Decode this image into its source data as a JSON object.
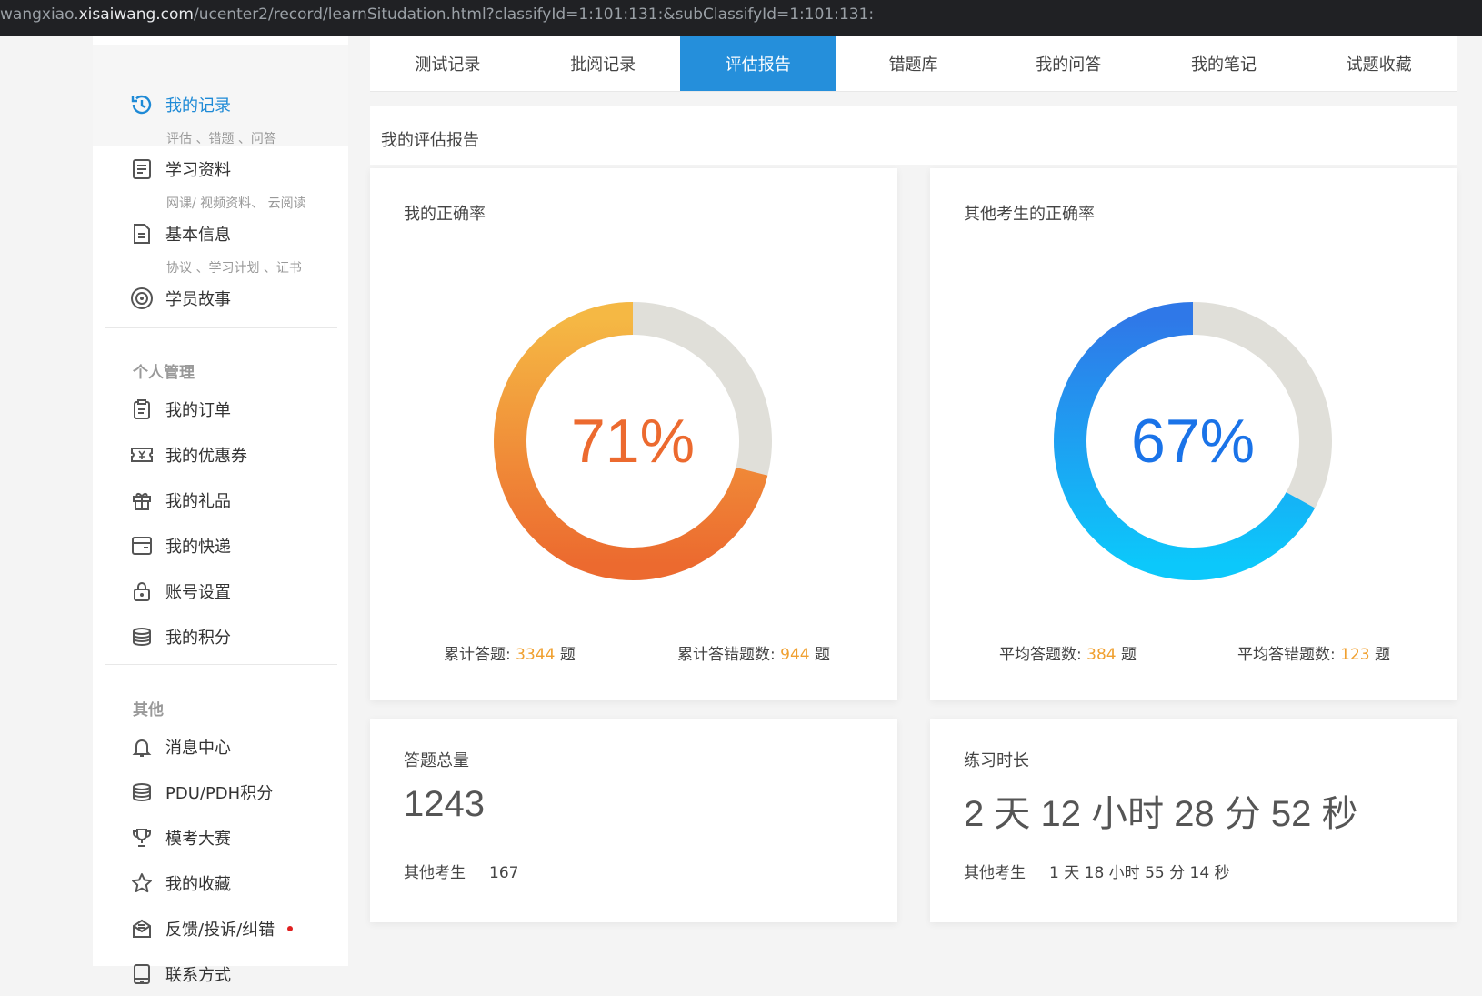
{
  "browser": {
    "url_prefix": "wangxiao.",
    "url_domain": "xisaiwang.com",
    "url_path": "/ucenter2/record/learnSitudation.html?classifyId=1:101:131:&subClassifyId=1:101:131:"
  },
  "sidebar": {
    "items": [
      {
        "label": "我的记录",
        "sub": "评估 、错题 、问答",
        "icon": "history-icon",
        "active": true
      },
      {
        "label": "学习资料",
        "sub": "网课/ 视频资料、 云阅读",
        "icon": "document-list-icon"
      },
      {
        "label": "基本信息",
        "sub": "协议 、学习计划 、证书",
        "icon": "file-icon"
      },
      {
        "label": "学员故事",
        "icon": "story-icon"
      }
    ],
    "group_personal": "个人管理",
    "personal_items": [
      {
        "label": "我的订单",
        "icon": "clipboard-icon"
      },
      {
        "label": "我的优惠券",
        "icon": "coupon-icon"
      },
      {
        "label": "我的礼品",
        "icon": "gift-icon"
      },
      {
        "label": "我的快递",
        "icon": "package-icon"
      },
      {
        "label": "账号设置",
        "icon": "lock-icon"
      },
      {
        "label": "我的积分",
        "icon": "coins-icon"
      }
    ],
    "group_other": "其他",
    "other_items": [
      {
        "label": "消息中心",
        "icon": "bell-icon"
      },
      {
        "label": "PDU/PDH积分",
        "icon": "coins-icon"
      },
      {
        "label": "模考大赛",
        "icon": "trophy-icon"
      },
      {
        "label": "我的收藏",
        "icon": "star-icon"
      },
      {
        "label": "反馈/投诉/纠错",
        "icon": "feedback-icon",
        "badge": true
      },
      {
        "label": "联系方式",
        "icon": "phone-icon"
      }
    ]
  },
  "tabs": [
    {
      "label": "测试记录"
    },
    {
      "label": "批阅记录"
    },
    {
      "label": "评估报告",
      "active": true
    },
    {
      "label": "错题库"
    },
    {
      "label": "我的问答"
    },
    {
      "label": "我的笔记"
    },
    {
      "label": "试题收藏"
    }
  ],
  "report": {
    "title": "我的评估报告",
    "my_accuracy": {
      "title": "我的正确率",
      "percent": 71,
      "percent_text": "71%",
      "total_label": "累计答题:",
      "total_value": "3344",
      "total_unit": "题",
      "wrong_label": "累计答错题数:",
      "wrong_value": "944",
      "wrong_unit": "题",
      "colors": {
        "start": "#ec6a2f",
        "end": "#f5b844",
        "track": "#e0dfd9",
        "text": "#ec6a2f"
      }
    },
    "others_accuracy": {
      "title": "其他考生的正确率",
      "percent": 67,
      "percent_text": "67%",
      "total_label": "平均答题数:",
      "total_value": "384",
      "total_unit": "题",
      "wrong_label": "平均答错题数:",
      "wrong_value": "123",
      "wrong_unit": "题",
      "colors": {
        "start": "#0cc8fb",
        "end": "#2f78e8",
        "track": "#e0dfd9",
        "text": "#1a73e8"
      }
    },
    "total_answers": {
      "title": "答题总量",
      "value": "1243",
      "other_label": "其他考生",
      "other_value": "167"
    },
    "practice_time": {
      "title": "练习时长",
      "value": "2 天 12 小时 28 分 52 秒",
      "other_label": "其他考生",
      "other_value": "1 天 18 小时 55 分 14 秒"
    }
  }
}
